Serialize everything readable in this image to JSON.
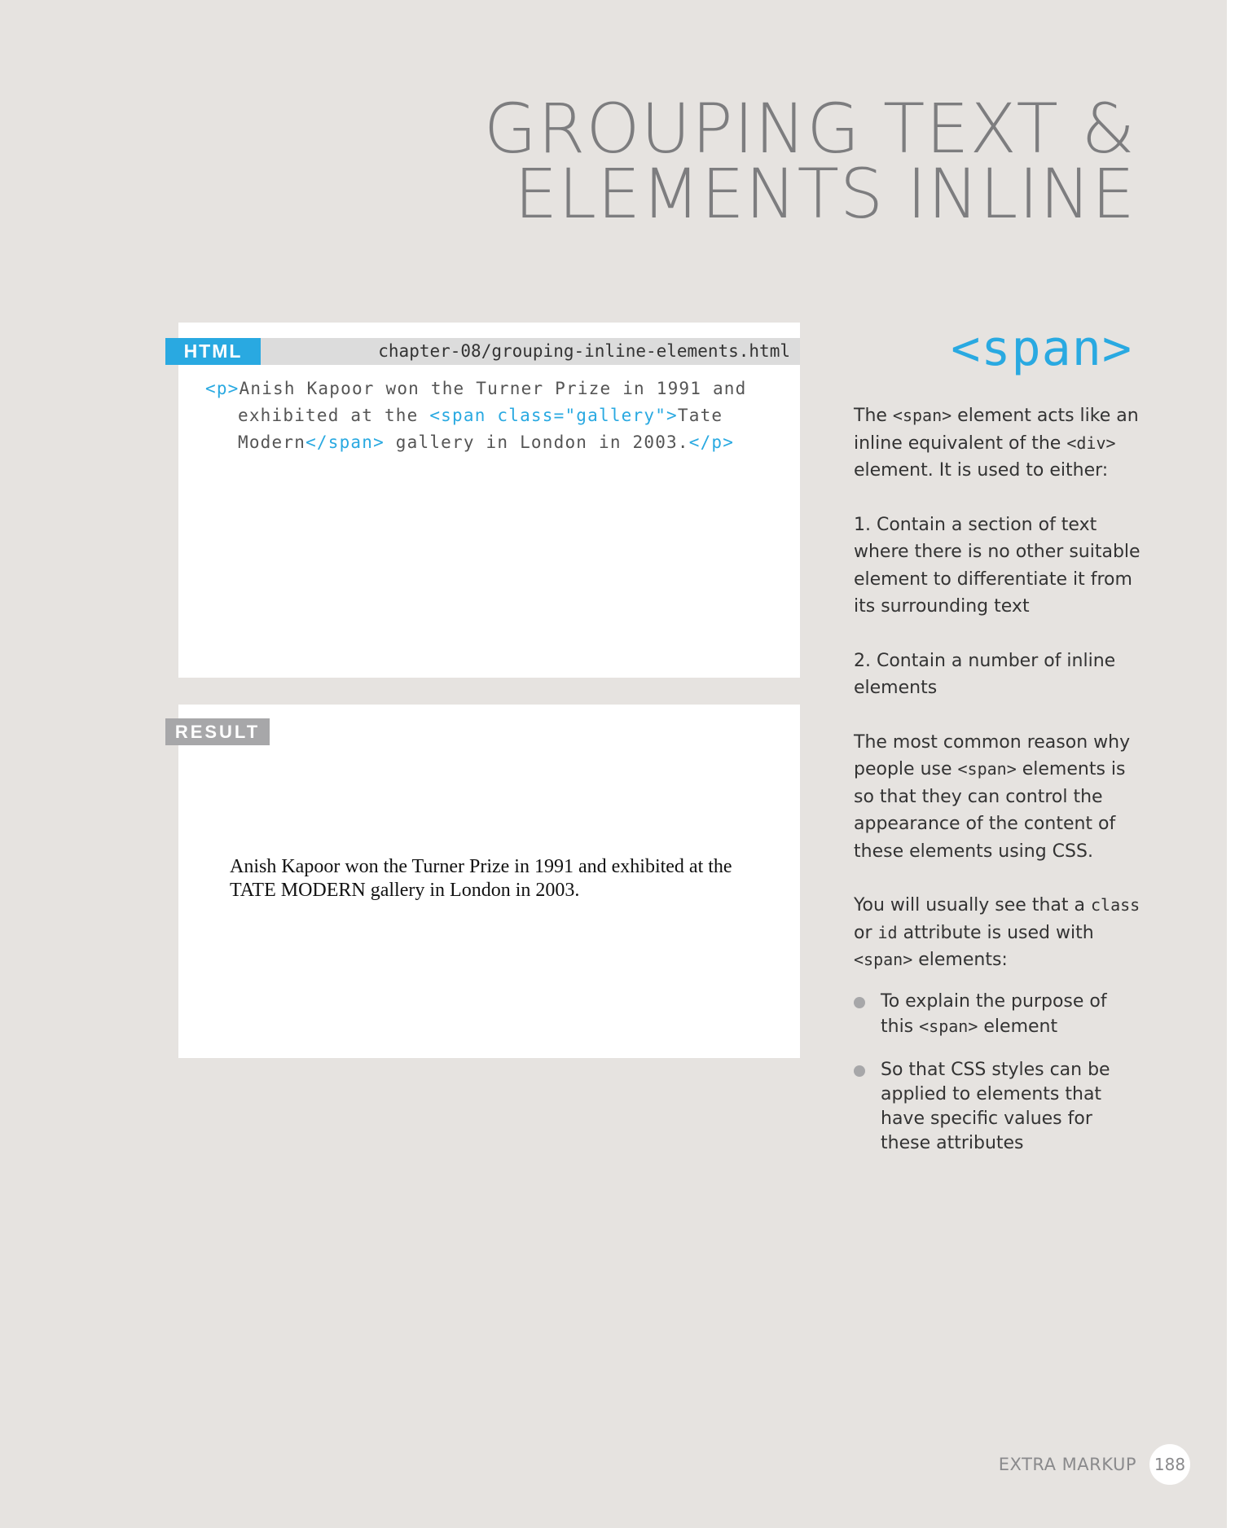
{
  "title": {
    "line1": "GROUPING TEXT &",
    "line2": "ELEMENTS INLINE"
  },
  "code_panel": {
    "label": "HTML",
    "file_path": "chapter-08/grouping-inline-elements.html",
    "code": {
      "p_open": "<p>",
      "text1": "Anish Kapoor won the Turner Prize in 1991 and",
      "text2": "exhibited at the ",
      "span_open": "<span class=\"gallery\">",
      "text3": "Tate",
      "text4": "Modern",
      "span_close": "</span>",
      "text5": " gallery in London in 2003.",
      "p_close": "</p>"
    }
  },
  "result_panel": {
    "label": "RESULT",
    "text": "Anish Kapoor won the Turner Prize in 1991 and exhibited at the TATE MODERN gallery in London in 2003."
  },
  "sidebar": {
    "heading": "<span>",
    "para1": {
      "a": "The ",
      "code1": "<span>",
      "b": " element acts like an inline equivalent of the ",
      "code2": "<div>",
      "c": " element. It is used to either:"
    },
    "para2": "1. Contain a section of text where there is no other suitable element to differentiate it from its surrounding text",
    "para3": "2. Contain a number of inline elements",
    "para4": {
      "a": "The most common reason why people use ",
      "code": "<span>",
      "b": " elements is so that they can control the appearance of the content of these elements using CSS."
    },
    "para5": {
      "a": "You will usually see that a ",
      "code1": "class",
      "b": " or ",
      "code2": "id",
      "c": " attribute is used with ",
      "code3": "<span>",
      "d": " elements:"
    },
    "bullets": {
      "b1": {
        "a": "To explain the purpose of this ",
        "code": "<span>",
        "b": " element"
      },
      "b2": "So that CSS styles can be applied to elements that have specific values for these attributes"
    }
  },
  "footer": {
    "section": "EXTRA MARKUP",
    "page_number": "188"
  }
}
